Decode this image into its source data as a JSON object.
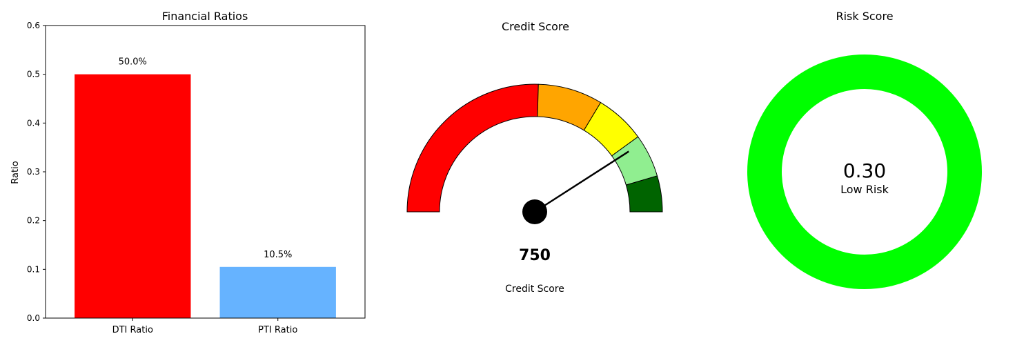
{
  "chart_data": [
    {
      "type": "bar",
      "title": "Financial Ratios",
      "xlabel": "",
      "ylabel": "Ratio",
      "ylim": [
        0,
        0.6
      ],
      "yticks": [
        "0.0",
        "0.1",
        "0.2",
        "0.3",
        "0.4",
        "0.5",
        "0.6"
      ],
      "categories": [
        "DTI Ratio",
        "PTI Ratio"
      ],
      "values": [
        0.5,
        0.105
      ],
      "data_labels": [
        "50.0%",
        "10.5%"
      ],
      "colors": [
        "#ff0000",
        "#66b3ff"
      ],
      "grid": false
    },
    {
      "type": "gauge",
      "title": "Credit Score",
      "value": 750,
      "value_label": "750",
      "caption": "Credit Score",
      "range": [
        300,
        850
      ],
      "segments": [
        {
          "from": 300,
          "to": 580,
          "color": "#ff0000"
        },
        {
          "from": 580,
          "to": 670,
          "color": "#ffa500"
        },
        {
          "from": 670,
          "to": 740,
          "color": "#ffff00"
        },
        {
          "from": 740,
          "to": 800,
          "color": "#90ee90"
        },
        {
          "from": 800,
          "to": 850,
          "color": "#006400"
        }
      ]
    },
    {
      "type": "donut",
      "title": "Risk Score",
      "value": 0.3,
      "value_label": "0.30",
      "category_label": "Low Risk",
      "color": "#00ff00"
    }
  ]
}
